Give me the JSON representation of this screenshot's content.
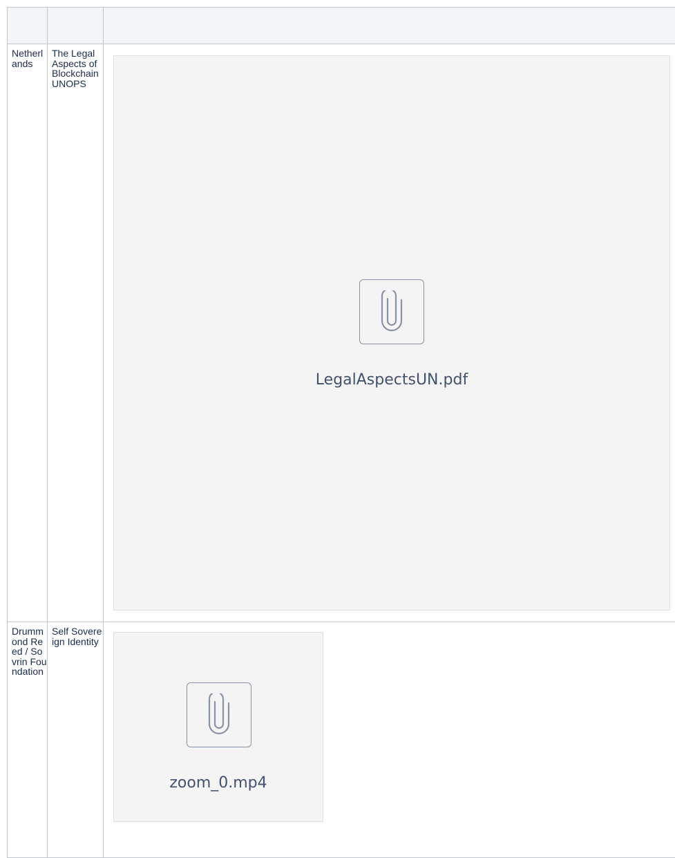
{
  "table": {
    "header": [
      "",
      "",
      ""
    ],
    "rows": [
      {
        "country": "Netherlands",
        "title": "The Legal Aspects of Blockchain UNOPS",
        "attachment": {
          "filename": "LegalAspectsUN.pdf",
          "icon": "paperclip-icon"
        }
      },
      {
        "country": "Drummond Reed / Sovrin Foundation",
        "title": "Self Sovereign Identity",
        "attachment": {
          "filename": "zoom_0.mp4",
          "icon": "paperclip-icon"
        }
      }
    ]
  }
}
